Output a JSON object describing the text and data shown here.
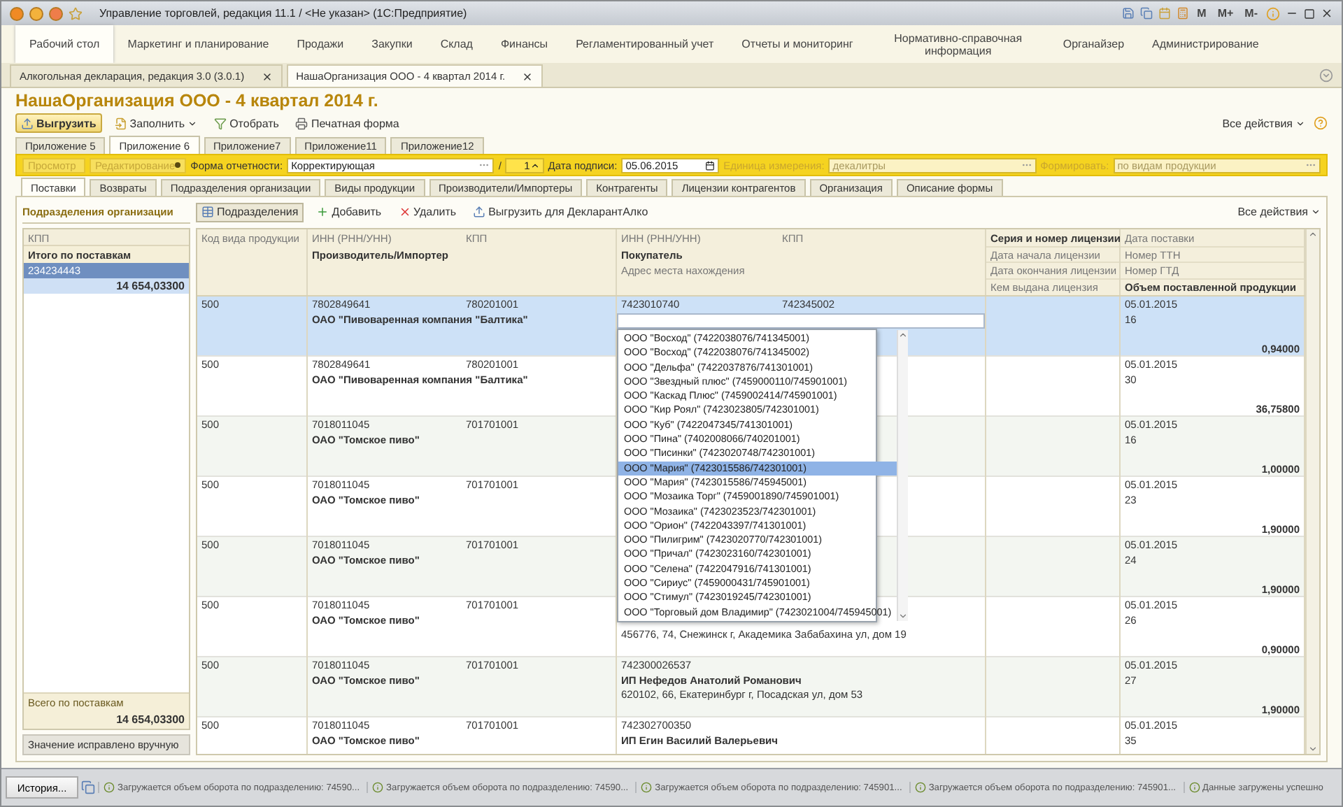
{
  "window": {
    "title": "Управление торговлей, редакция 11.1 / <Не указан> (1С:Предприятие)",
    "calc_buttons": [
      "M",
      "M+",
      "M-"
    ]
  },
  "sections": [
    {
      "label": "Рабочий стол",
      "selected": true
    },
    {
      "label": "Маркетинг и планирование",
      "selected": false
    },
    {
      "label": "Продажи",
      "selected": false
    },
    {
      "label": "Закупки",
      "selected": false
    },
    {
      "label": "Склад",
      "selected": false
    },
    {
      "label": "Финансы",
      "selected": false
    },
    {
      "label": "Регламентированный учет",
      "selected": false
    },
    {
      "label": "Отчеты и мониторинг",
      "selected": false
    },
    {
      "label": "Нормативно-справочная информация",
      "selected": false
    },
    {
      "label": "Органайзер",
      "selected": false
    },
    {
      "label": "Администрирование",
      "selected": false
    }
  ],
  "open_tabs": [
    {
      "label": "Алкогольная декларация, редакция 3.0 (3.0.1)",
      "selected": false
    },
    {
      "label": "НашаОрганизация ООО - 4 квартал 2014 г.",
      "selected": true
    }
  ],
  "form": {
    "title": "НашаОрганизация ООО - 4 квартал 2014 г.",
    "all_actions": "Все действия",
    "toolbar": [
      {
        "label": "Выгрузить",
        "kind": "primary"
      },
      {
        "label": "Заполнить",
        "kind": "fill"
      },
      {
        "label": "Отобрать",
        "kind": "filter"
      },
      {
        "label": "Печатная форма",
        "kind": "print"
      }
    ]
  },
  "appendix_tabs": [
    {
      "label": "Приложение 5",
      "selected": false
    },
    {
      "label": "Приложение 6",
      "selected": true
    },
    {
      "label": "Приложение7",
      "selected": false
    },
    {
      "label": "Приложение11",
      "selected": false
    },
    {
      "label": "Приложение12",
      "selected": false
    }
  ],
  "filter_bar": {
    "modes": [
      {
        "label": "Просмотр",
        "kind": "field",
        "disabled": true
      },
      {
        "label": "Редактирование",
        "kind": "radio",
        "disabled": true
      }
    ],
    "fields": [
      {
        "label": "Форма отчетности:",
        "value": "Корректирующая",
        "kind": "select",
        "disabled": false
      },
      {
        "label": "/",
        "value": "1",
        "kind": "number",
        "disabled": false
      },
      {
        "label": "Дата подписи:",
        "value": "05.06.2015",
        "kind": "date",
        "disabled": false
      },
      {
        "label": "Единица измерения:",
        "value": "декалитры",
        "kind": "select",
        "disabled": true
      },
      {
        "label": "Формировать:",
        "value": "по видам продукции",
        "kind": "select",
        "disabled": true
      }
    ]
  },
  "sub_tabs": [
    {
      "label": "Поставки",
      "selected": true
    },
    {
      "label": "Возвраты",
      "selected": false
    },
    {
      "label": "Подразделения организации",
      "selected": false
    },
    {
      "label": "Виды продукции",
      "selected": false
    },
    {
      "label": "Производители/Импортеры",
      "selected": false
    },
    {
      "label": "Контрагенты",
      "selected": false
    },
    {
      "label": "Лицензии контрагентов",
      "selected": false
    },
    {
      "label": "Организация",
      "selected": false
    },
    {
      "label": "Описание формы",
      "selected": false
    }
  ],
  "left_panel": {
    "title": "Подразделения организации",
    "column": "КПП",
    "group_label": "Итого по поставкам",
    "items": [
      {
        "kpp": "234234443",
        "total": "14 654,03300",
        "selected": true
      }
    ],
    "footer_label": "Всего по поставкам",
    "footer_total": "14 654,03300",
    "note": "Значение исправлено вручную"
  },
  "grid_toolbar": {
    "all_actions": "Все действия",
    "buttons": [
      {
        "label": "Подразделения",
        "kind": "toggle",
        "on": true
      },
      {
        "label": "Добавить",
        "kind": "add",
        "on": false
      },
      {
        "label": "Удалить",
        "kind": "delete",
        "on": false
      },
      {
        "label": "Выгрузить для ДекларантАлко",
        "kind": "export",
        "on": false
      }
    ]
  },
  "table": {
    "columns": {
      "product_code": "Код вида продукции",
      "maker_inn": "ИНН (РНН/УНН)",
      "maker_kpp": "КПП",
      "maker": "Производитель/Импортер",
      "buyer_inn": "ИНН (РНН/УНН)",
      "buyer_kpp": "КПП",
      "buyer": "Покупатель",
      "buyer_address": "Адрес места нахождения",
      "license_number": "Серия и номер лицензии",
      "license_start": "Дата начала лицензии",
      "license_end": "Дата окончания лицензии",
      "license_issuer": "Кем выдана лицензия",
      "delivery_date": "Дата поставки",
      "waybill": "Номер ТТН",
      "customs_declaration": "Номер ГТД",
      "volume": "Объем поставленной продукции"
    },
    "rows": [
      {
        "selected": true,
        "product_code": "500",
        "maker_inn": "7802849641",
        "maker_kpp": "780201001",
        "maker": "ОАО \"Пивоваренная компания \"Балтика\"",
        "buyer_inn": "7423010740",
        "buyer_kpp": "742345002",
        "delivery_date": "05.01.2015",
        "waybill": "16",
        "volume": "0,94000",
        "buyer_dropdown": [
          {
            "label": "ООО \"Восход\" (7422038076/741345001)",
            "selected": false
          },
          {
            "label": "ООО \"Восход\" (7422038076/741345002)",
            "selected": false
          },
          {
            "label": "ООО \"Дельфа\" (7422037876/741301001)",
            "selected": false
          },
          {
            "label": "ООО \"Звездный плюс\" (7459000110/745901001)",
            "selected": false
          },
          {
            "label": "ООО \"Каскад Плюс\" (7459002414/745901001)",
            "selected": false
          },
          {
            "label": "ООО \"Кир Роял\" (7423023805/742301001)",
            "selected": false
          },
          {
            "label": "ООО \"Куб\" (7422047345/741301001)",
            "selected": false
          },
          {
            "label": "ООО \"Пина\" (7402008066/740201001)",
            "selected": false
          },
          {
            "label": "ООО \"Писинки\" (7423020748/742301001)",
            "selected": false
          },
          {
            "label": "ООО \"Мария\" (7423015586/742301001)",
            "selected": true
          },
          {
            "label": "ООО \"Мария\" (7423015586/745945001)",
            "selected": false
          },
          {
            "label": "ООО \"Мозаика Торг\" (7459001890/745901001)",
            "selected": false
          },
          {
            "label": "ООО \"Мозаика\" (7423023523/742301001)",
            "selected": false
          },
          {
            "label": "ООО \"Орион\" (7422043397/741301001)",
            "selected": false
          },
          {
            "label": "ООО \"Пилигрим\" (7423020770/742301001)",
            "selected": false
          },
          {
            "label": "ООО \"Причал\" (7423023160/742301001)",
            "selected": false
          },
          {
            "label": "ООО \"Селена\" (7422047916/741301001)",
            "selected": false
          },
          {
            "label": "ООО \"Сириус\" (7459000431/745901001)",
            "selected": false
          },
          {
            "label": "ООО \"Стимул\" (7423019245/742301001)",
            "selected": false
          },
          {
            "label": "ООО \"Торговый дом Владимир\" (7423021004/745945001)",
            "selected": false
          }
        ]
      },
      {
        "selected": false,
        "product_code": "500",
        "maker_inn": "7802849641",
        "maker_kpp": "780201001",
        "maker": "ОАО \"Пивоваренная компания \"Балтика\"",
        "delivery_date": "05.01.2015",
        "waybill": "30",
        "volume": "36,75800"
      },
      {
        "selected": false,
        "product_code": "500",
        "maker_inn": "7018011045",
        "maker_kpp": "701701001",
        "maker": "ОАО \"Томское пиво\"",
        "delivery_date": "05.01.2015",
        "waybill": "16",
        "volume": "1,00000"
      },
      {
        "selected": false,
        "product_code": "500",
        "maker_inn": "7018011045",
        "maker_kpp": "701701001",
        "maker": "ОАО \"Томское пиво\"",
        "delivery_date": "05.01.2015",
        "waybill": "23",
        "volume": "1,90000"
      },
      {
        "selected": false,
        "product_code": "500",
        "maker_inn": "7018011045",
        "maker_kpp": "701701001",
        "maker": "ОАО \"Томское пиво\"",
        "delivery_date": "05.01.2015",
        "waybill": "24",
        "volume": "1,90000"
      },
      {
        "selected": false,
        "product_code": "500",
        "maker_inn": "7018011045",
        "maker_kpp": "701701001",
        "maker": "ОАО \"Томское пиво\"",
        "buyer_address": "456776, 74, Снежинск г, Академика Забабахина ул, дом 19",
        "delivery_date": "05.01.2015",
        "waybill": "26",
        "volume": "0,90000"
      },
      {
        "selected": false,
        "product_code": "500",
        "maker_inn": "7018011045",
        "maker_kpp": "701701001",
        "maker": "ОАО \"Томское пиво\"",
        "buyer_inn": "742300026537",
        "buyer": "ИП Нефедов Анатолий Романович",
        "buyer_address": "620102, 66, Екатеринбург г, Посадская ул, дом 53",
        "delivery_date": "05.01.2015",
        "waybill": "27",
        "volume": "1,90000"
      },
      {
        "selected": false,
        "product_code": "500",
        "maker_inn": "7018011045",
        "maker_kpp": "701701001",
        "maker": "ОАО \"Томское пиво\"",
        "buyer_inn": "742302700350",
        "buyer": "ИП Егин Василий Валерьевич",
        "delivery_date": "05.01.2015",
        "waybill": "35"
      }
    ]
  },
  "status_bar": {
    "history_button": "История...",
    "messages": [
      "Загружается объем оборота по подразделению: 74590...",
      "Загружается объем оборота по подразделению: 74590...",
      "Загружается объем оборота по подразделению: 745901...",
      "Загружается объем оборота по подразделению: 745901...",
      "Данные загружены успешно"
    ]
  }
}
